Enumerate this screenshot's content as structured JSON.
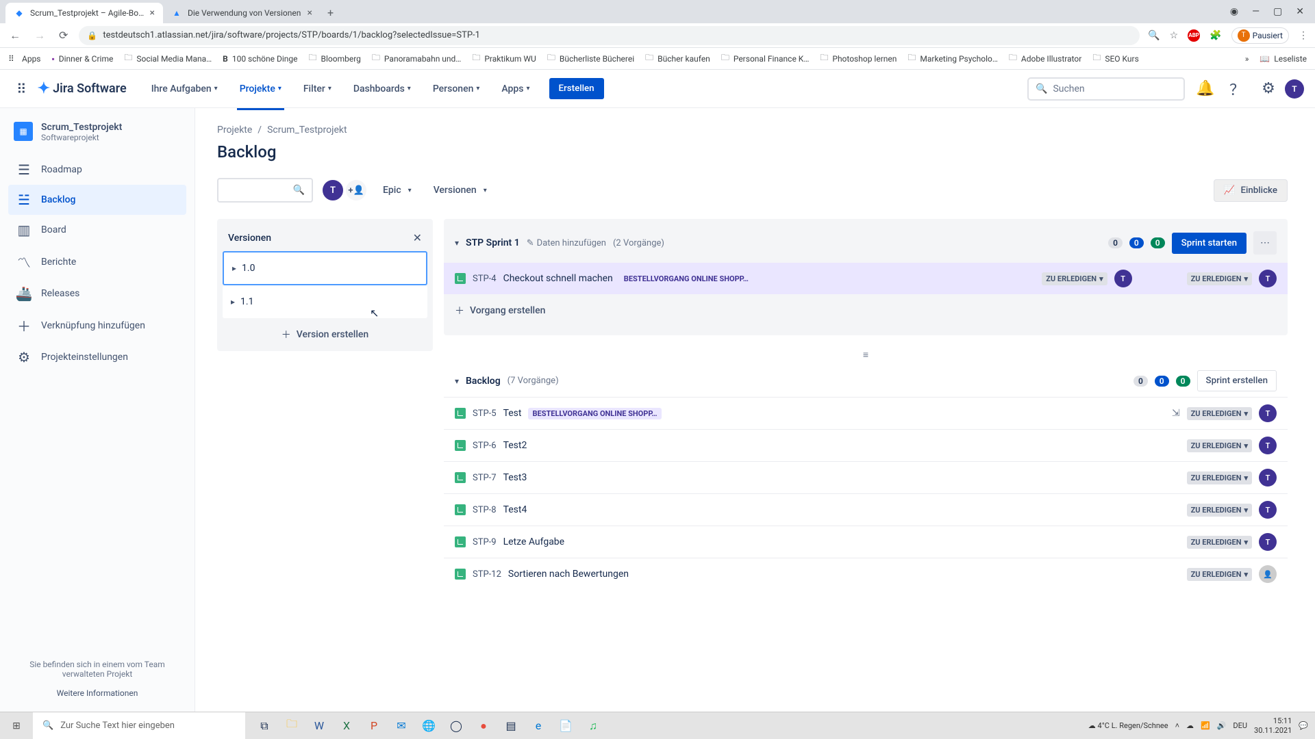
{
  "browser": {
    "tabs": [
      {
        "title": "Scrum_Testprojekt – Agile-Board",
        "favicon": "jira"
      },
      {
        "title": "Die Verwendung von Versionen",
        "favicon": "atlassian"
      }
    ],
    "url": "testdeutsch1.atlassian.net/jira/software/projects/STP/boards/1/backlog?selectedIssue=STP-1",
    "profile_status": "Pausiert",
    "bookmarks": [
      "Apps",
      "Dinner & Crime",
      "Social Media Mana…",
      "100 schöne Dinge",
      "Bloomberg",
      "Panoramabahn und…",
      "Praktikum WU",
      "Bücherliste Bücherei",
      "Bücher kaufen",
      "Personal Finance K…",
      "Photoshop lernen",
      "Marketing Psycholo…",
      "Adobe Illustrator",
      "SEO Kurs"
    ],
    "reading_list": "Leseliste"
  },
  "nav": {
    "product": "Jira Software",
    "items": [
      "Ihre Aufgaben",
      "Projekte",
      "Filter",
      "Dashboards",
      "Personen",
      "Apps"
    ],
    "active_index": 1,
    "create": "Erstellen",
    "search_placeholder": "Suchen",
    "avatar_initial": "T"
  },
  "sidebar": {
    "project_name": "Scrum_Testprojekt",
    "project_type": "Softwareprojekt",
    "items": [
      "Roadmap",
      "Backlog",
      "Board",
      "Berichte",
      "Releases",
      "Verknüpfung hinzufügen",
      "Projekteinstellungen"
    ],
    "active_index": 1,
    "footer_text": "Sie befinden sich in einem vom Team verwalteten Projekt",
    "footer_link": "Weitere Informationen"
  },
  "page": {
    "breadcrumb": [
      "Projekte",
      "Scrum_Testprojekt"
    ],
    "title": "Backlog",
    "epic_filter": "Epic",
    "versions_filter": "Versionen",
    "insights": "Einblicke"
  },
  "versions_panel": {
    "title": "Versionen",
    "items": [
      "1.0",
      "1.1"
    ],
    "selected_index": 0,
    "create": "Version erstellen"
  },
  "sprint": {
    "name": "STP Sprint 1",
    "add_data": "Daten hinzufügen",
    "count": "(2 Vorgänge)",
    "pills": [
      "0",
      "0",
      "0"
    ],
    "start": "Sprint starten",
    "issues": [
      {
        "key": "STP-4",
        "summary": "Checkout schnell machen",
        "epic": "BESTELLVORGANG ONLINE SHOPP…",
        "status": "ZU ERLEDIGEN",
        "assignee": "T",
        "highlighted": true,
        "has_left_status": true
      }
    ],
    "create_issue": "Vorgang erstellen"
  },
  "backlog": {
    "name": "Backlog",
    "count": "(7 Vorgänge)",
    "pills": [
      "0",
      "0",
      "0"
    ],
    "create_sprint": "Sprint erstellen",
    "issues": [
      {
        "key": "STP-5",
        "summary": "Test",
        "epic": "BESTELLVORGANG ONLINE SHOPP…",
        "status": "ZU ERLEDIGEN",
        "assignee": "T",
        "has_children": true
      },
      {
        "key": "STP-6",
        "summary": "Test2",
        "status": "ZU ERLEDIGEN",
        "assignee": "T"
      },
      {
        "key": "STP-7",
        "summary": "Test3",
        "status": "ZU ERLEDIGEN",
        "assignee": "T"
      },
      {
        "key": "STP-8",
        "summary": "Test4",
        "status": "ZU ERLEDIGEN",
        "assignee": "T"
      },
      {
        "key": "STP-9",
        "summary": "Letze Aufgabe",
        "status": "ZU ERLEDIGEN",
        "assignee": "T"
      },
      {
        "key": "STP-12",
        "summary": "Sortieren nach Bewertungen",
        "status": "ZU ERLEDIGEN",
        "assignee": ""
      }
    ]
  },
  "taskbar": {
    "search": "Zur Suche Text hier eingeben",
    "weather": "4°C  L. Regen/Schnee",
    "lang": "DEU",
    "time": "15:11",
    "date": "30.11.2021"
  }
}
